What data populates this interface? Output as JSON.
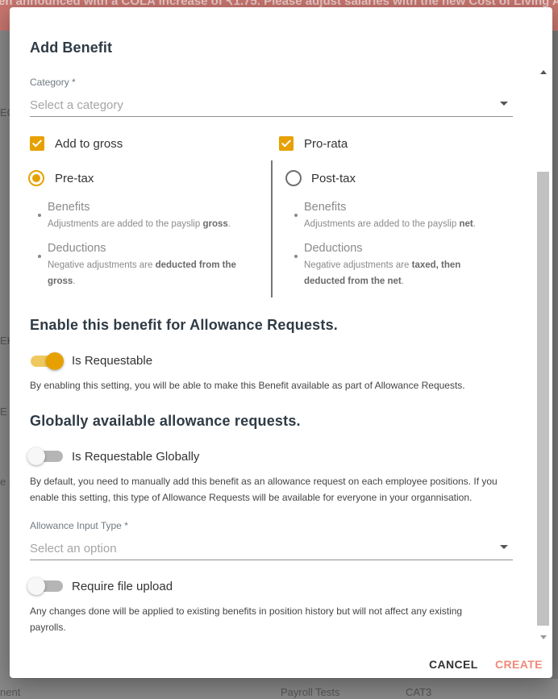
{
  "background": {
    "banner_text": "en announced with a COLA increase of ₹1.75. Please adjust salaries with the new Cost of Living All",
    "fragments": [
      "EG",
      "EH",
      "E",
      "e F"
    ],
    "bottom_left": "nent",
    "bottom_mid": "Payroll Tests",
    "bottom_right": "CAT3"
  },
  "dialog": {
    "title": "Add Benefit",
    "category": {
      "label": "Category *",
      "placeholder": "Select a category"
    },
    "add_to_gross": {
      "label": "Add to gross",
      "checked": true
    },
    "pro_rata": {
      "label": "Pro-rata",
      "checked": true
    },
    "pre_tax": {
      "label": "Pre-tax",
      "selected": true,
      "benefits_title": "Benefits",
      "benefits_desc_pre": "Adjustments are added to the payslip ",
      "benefits_desc_bold": "gross",
      "deductions_title": "Deductions",
      "deductions_desc_pre": "Negative adjustments are ",
      "deductions_desc_bold1": "deducted from the",
      "deductions_desc_bold2": "gross"
    },
    "post_tax": {
      "label": "Post-tax",
      "selected": false,
      "benefits_title": "Benefits",
      "benefits_desc_pre": "Adjustments are added to the payslip ",
      "benefits_desc_bold": "net",
      "deductions_title": "Deductions",
      "deductions_desc_pre": "Negative adjustments are ",
      "deductions_desc_bold1": "taxed, then",
      "deductions_desc_bold2": "deducted from the net"
    },
    "requests_section_title": "Enable this benefit for Allowance Requests.",
    "is_requestable": {
      "label": "Is Requestable",
      "on": true
    },
    "requestable_help": "By enabling this setting, you will be able to make this Benefit available as part of Allowance Requests.",
    "global_section_title": "Globally available allowance requests.",
    "is_requestable_globally": {
      "label": "Is Requestable Globally",
      "on": false
    },
    "global_help_line1": "By default, you need to manually add this benefit as an allowance request on each employee positions. If you",
    "global_help_line2": "enable this setting, this type of Allowance Requests will be available for everyone in your organnisation.",
    "allowance_input_type": {
      "label": "Allowance Input Type *",
      "placeholder": "Select an option"
    },
    "require_file_upload": {
      "label": "Require file upload",
      "on": false
    },
    "footer_help_line1": "Any changes done will be applied to existing benefits in position history but will not affect any existing",
    "footer_help_line2": "payrolls.",
    "cancel_label": "CANCEL",
    "create_label": "CREATE"
  },
  "colors": {
    "accent": "#e6a100",
    "create_button": "#f08a7a",
    "banner": "#c8766f"
  }
}
